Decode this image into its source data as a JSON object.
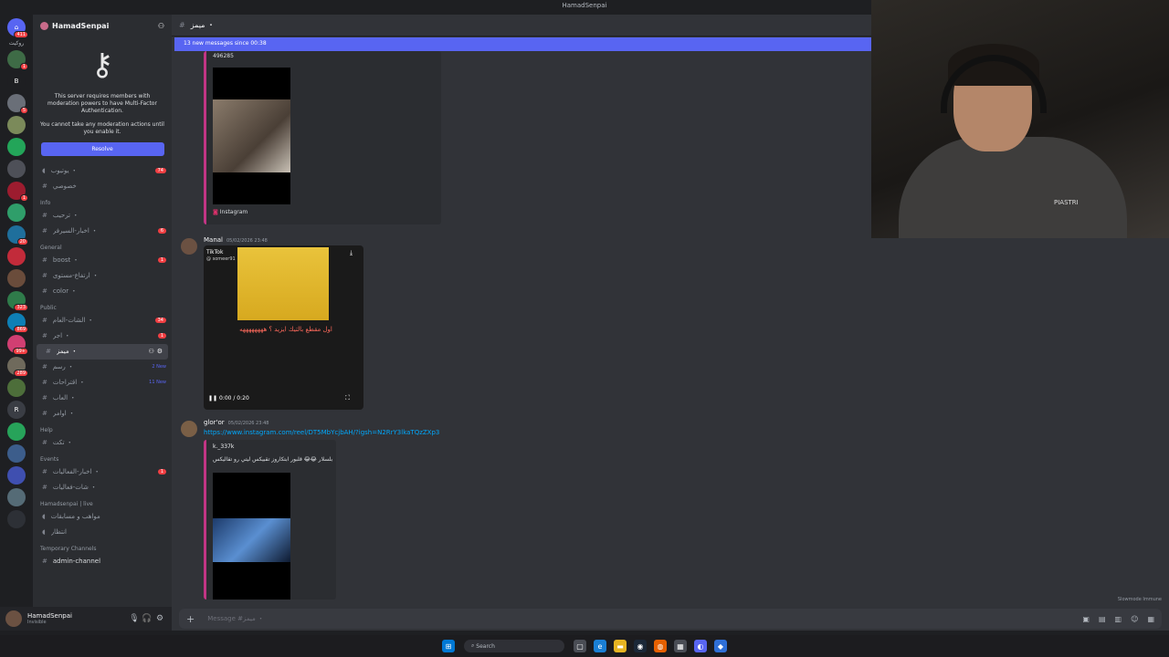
{
  "window": {
    "title": "HamadSenpai"
  },
  "server": {
    "name": "HamadSenpai"
  },
  "mfa": {
    "line1": "This server requires members with moderation powers to have Multi-Factor Authentication.",
    "line2": "You cannot take any moderation actions until you enable it.",
    "resolve_label": "Resolve"
  },
  "categories": {
    "info": "Info",
    "general": "General",
    "public": "Public",
    "help": "Help",
    "events": "Events",
    "live": "Hamadsenpai | live",
    "temporary": "Temporary Channels"
  },
  "channels": {
    "youtube": {
      "label": "يوتيوب ・",
      "badge": "74"
    },
    "hidden": {
      "label": "خصوصي"
    },
    "welcome": {
      "label": "ترحيب ・"
    },
    "serverNews": {
      "label": "اخبار-السيرفر ・",
      "badge": "6"
    },
    "boost": {
      "label": "boost ・",
      "badge": "1"
    },
    "levels": {
      "label": "ارتفاع-مستوى ・"
    },
    "color": {
      "label": "color ・"
    },
    "chat": {
      "label": "الشات-العام ・",
      "badge": "34"
    },
    "ajr": {
      "label": "اجر ・",
      "badge": "1"
    },
    "memes": {
      "label": "ميمز ・"
    },
    "drawing": {
      "label": "رسم ・",
      "new": "2 New"
    },
    "suggestions": {
      "label": "اقتراحات ・",
      "new": "11 New"
    },
    "games": {
      "label": "العاب ・"
    },
    "commands": {
      "label": "اوامر ・"
    },
    "tickets": {
      "label": "تكت ・"
    },
    "eventNews": {
      "label": "اخبار-الفعاليات ・",
      "badge": "1"
    },
    "eventChat": {
      "label": "شات-فعاليات ・"
    },
    "voice1": {
      "label": "مواهب و مسابقات"
    },
    "voice2": {
      "label": "انتظار"
    },
    "admin": {
      "label": "admin-channel"
    }
  },
  "user": {
    "name": "HamadSenpai",
    "status": "Invisible"
  },
  "channel_header": {
    "name": "ميمز ・"
  },
  "newbar": {
    "text": "13 new messages since 00:38"
  },
  "messages": {
    "first": {
      "id_fragment": "496285",
      "source": "Instagram"
    },
    "second": {
      "author": "Manal",
      "timestamp": "05/02/2026 23:48",
      "tiktok": "TikTok",
      "tiktok_user": "@ someer91",
      "caption": "اول مقطع بالتيك ايزيد ؟ ههههههههه",
      "time": "0:00 / 0:20"
    },
    "third": {
      "author": "glor'or",
      "timestamp": "05/02/2026 23:48",
      "link": "https://www.instagram.com/reel/DT5MbYcjbAH/?igsh=N2RrY3lkaTQzZXp3",
      "reply_user": "k._337k",
      "reply_text": "بلسلار 😂😂 قلبور ابتكاروز تقبيكس ليتي رو تقاليكس"
    }
  },
  "composer": {
    "placeholder": "Message #ميمز ・"
  },
  "webcam": {
    "brand": "PIASTRI"
  },
  "slowmode": "Slowmode Immune",
  "taskbar": {
    "search": "Search"
  }
}
